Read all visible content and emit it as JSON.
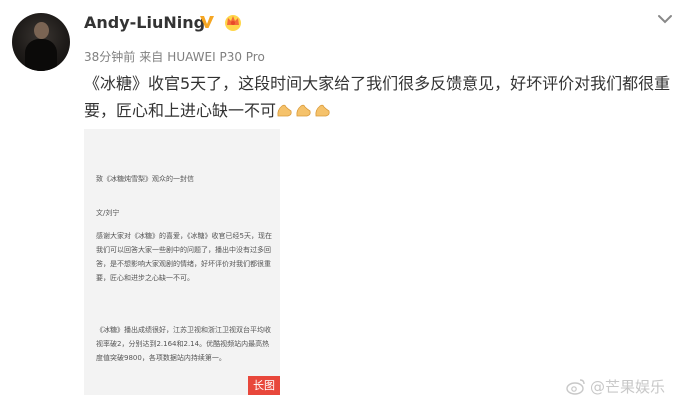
{
  "user": {
    "name": "Andy-LiuNing",
    "time": "38分钟前",
    "source_prefix": "来自",
    "device": "HUAWEI P30 Pro"
  },
  "post": {
    "text": "《冰糖》收官5天了，这段时间大家给了我们很多反馈意见，好坏评价对我们都很重要，匠心和上进心缺一不可"
  },
  "letter": {
    "title": "致《冰糖炖雪梨》观众的一封信",
    "author": "文/刘宁",
    "paragraph1": "感谢大家对《冰糖》的喜爱，《冰糖》收官已经5天，现在我们可以回答大家一些剧中的问题了，播出中没有过多回答，是不想影响大家观剧的情绪，好坏评价对我们都很重要，匠心和进步之心缺一不可。",
    "paragraph2": "《冰糖》播出成绩很好，江苏卫视和浙江卫视双台平均收视率破2，分别达到2.164和2.14。优酷视频站内最高热度值突破9800，各项数据站内持续第一。",
    "long_image_label": "长图"
  },
  "watermark": "@芒果娱乐",
  "icons": {
    "verified": "verified-v-icon",
    "crown": "crown-member-icon",
    "more": "chevron-down-icon",
    "emoji": "folded-hands-emoji-icon",
    "weibo": "weibo-logo-icon"
  },
  "colors": {
    "name": "#333333",
    "meta": "#808080",
    "badge": "#f5a623",
    "long_image_tag": "#e8473b",
    "watermark": "#c8c8c8"
  }
}
